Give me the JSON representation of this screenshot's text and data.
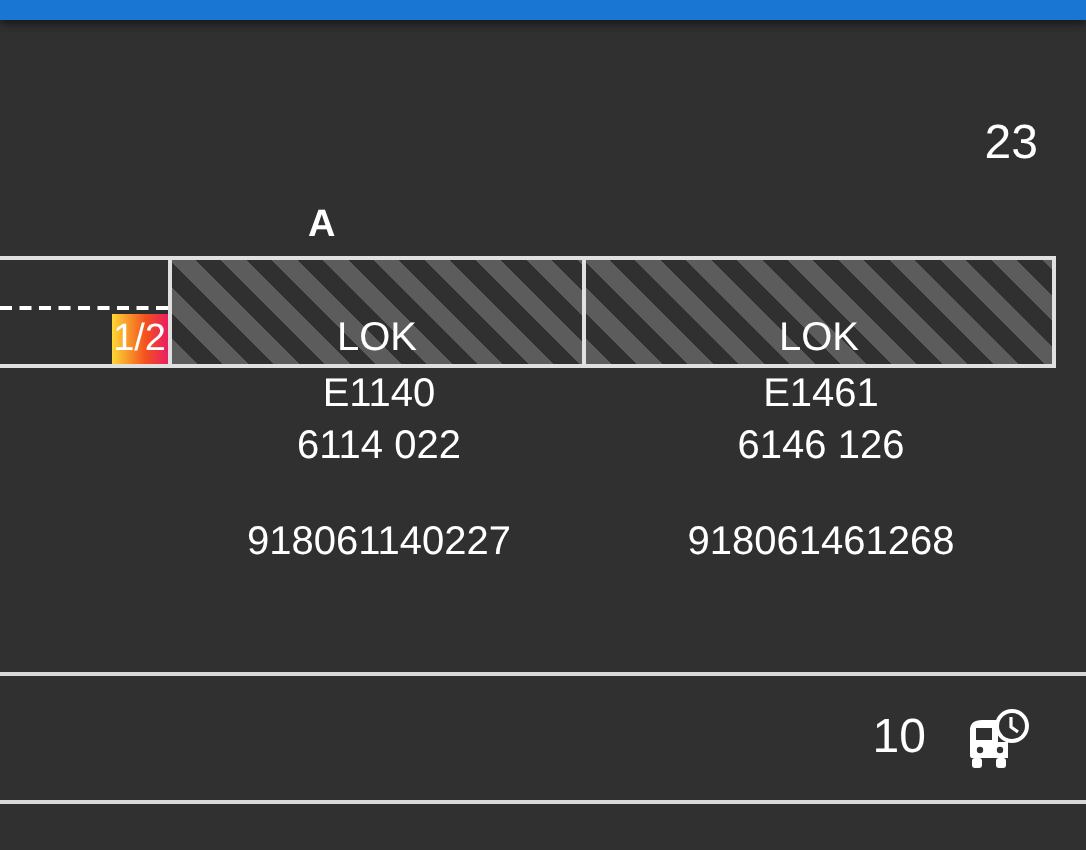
{
  "header": {
    "count": "23"
  },
  "train": {
    "section_label": "A",
    "cars": [
      {
        "kind": "partial",
        "badge": "1/2"
      },
      {
        "kind": "locomotive",
        "label": "LOK",
        "number": "E1140",
        "designation": "6114 022",
        "uic": "918061140227"
      },
      {
        "kind": "locomotive",
        "label": "LOK",
        "number": "E1461",
        "designation": "6146 126",
        "uic": "918061461268"
      }
    ]
  },
  "rows": [
    {
      "count": "10"
    }
  ]
}
